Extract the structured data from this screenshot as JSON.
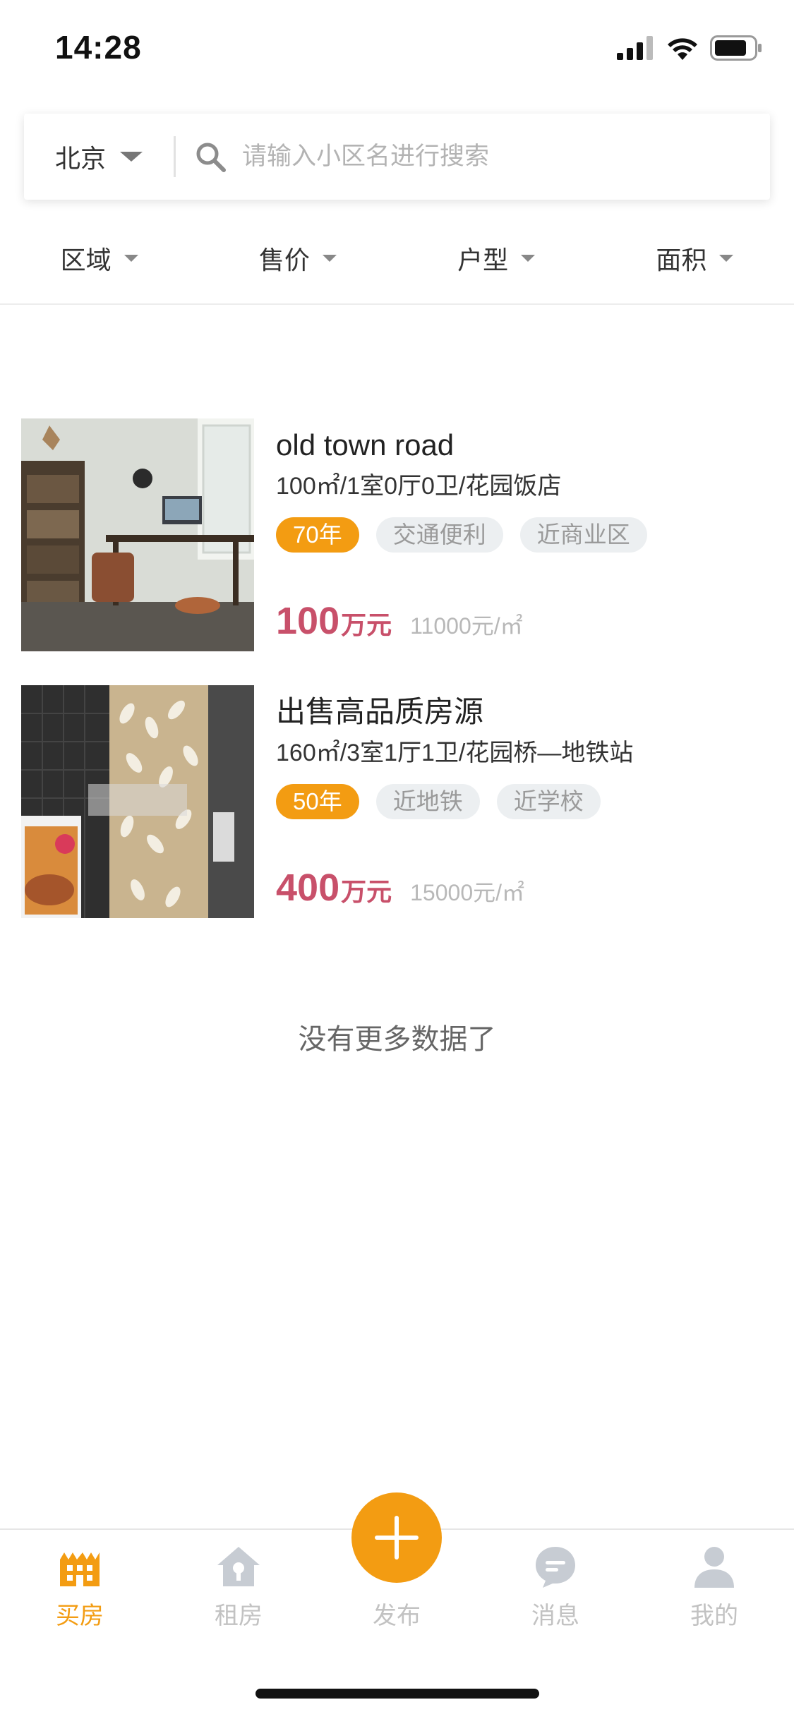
{
  "status_bar": {
    "time": "14:28"
  },
  "search": {
    "city": "北京",
    "placeholder": "请输入小区名进行搜索",
    "value": ""
  },
  "filters": [
    {
      "label": "区域"
    },
    {
      "label": "售价"
    },
    {
      "label": "户型"
    },
    {
      "label": "面积"
    }
  ],
  "listings": [
    {
      "title": "old town road",
      "specs": "100㎡/1室0厅0卫/花园饭店",
      "tags": [
        "70年",
        "交通便利",
        "近商业区"
      ],
      "price": "100",
      "price_unit": "万元",
      "unit_price": "11000元/㎡",
      "image": "room-photo"
    },
    {
      "title": "出售高品质房源",
      "specs": "160㎡/3室1厅1卫/花园桥—地铁站",
      "tags": [
        "50年",
        "近地铁",
        "近学校"
      ],
      "price": "400",
      "price_unit": "万元",
      "unit_price": "15000元/㎡",
      "image": "building-photo"
    }
  ],
  "no_more_text": "没有更多数据了",
  "tab_bar": {
    "tabs": [
      {
        "label": "买房",
        "icon": "building-icon",
        "active": true
      },
      {
        "label": "租房",
        "icon": "house-key-icon",
        "active": false
      },
      {
        "label": "发布",
        "icon": "plus-icon",
        "active": false
      },
      {
        "label": "消息",
        "icon": "chat-bubble-icon",
        "active": false
      },
      {
        "label": "我的",
        "icon": "user-icon",
        "active": false
      }
    ]
  },
  "colors": {
    "accent": "#f39c12",
    "price": "#c8506a",
    "tag_bg": "#eceff1",
    "inactive": "#c2c2c2"
  }
}
